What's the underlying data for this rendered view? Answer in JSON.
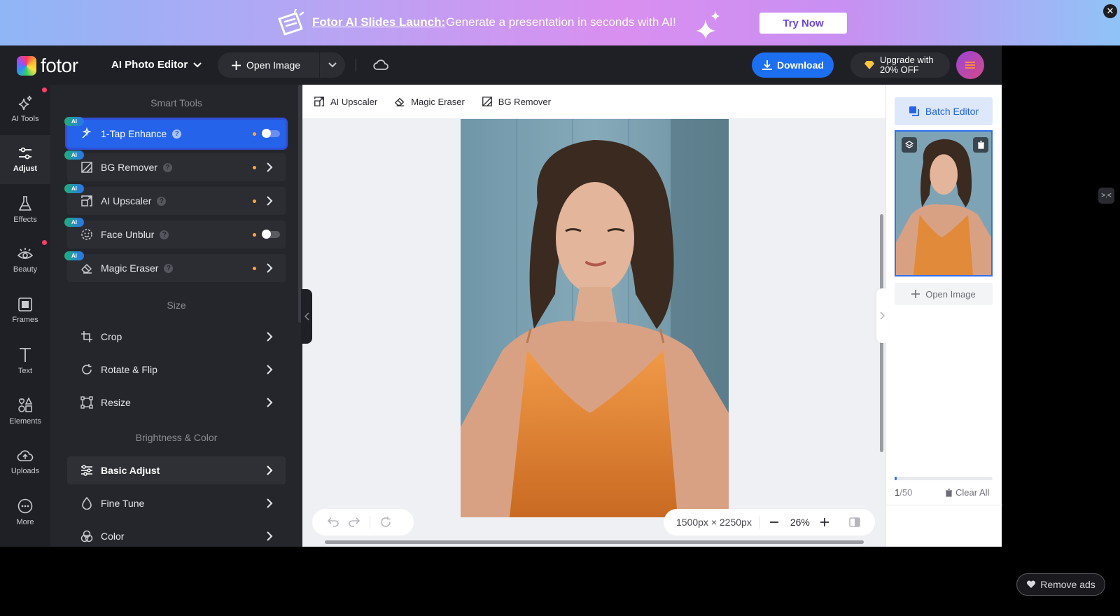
{
  "banner": {
    "title": "Fotor AI Slides Launch:",
    "text": "Generate a presentation in seconds with AI!",
    "cta": "Try Now",
    "close": "✕"
  },
  "topbar": {
    "logo": "fotor",
    "editor_mode": "AI Photo Editor",
    "open_image": "Open Image",
    "download": "Download",
    "upgrade_line1": "Upgrade with",
    "upgrade_line2": "20% OFF"
  },
  "rail": [
    {
      "label": "AI Tools"
    },
    {
      "label": "Adjust"
    },
    {
      "label": "Effects"
    },
    {
      "label": "Beauty"
    },
    {
      "label": "Frames"
    },
    {
      "label": "Text"
    },
    {
      "label": "Elements"
    },
    {
      "label": "Uploads"
    },
    {
      "label": "More"
    }
  ],
  "panel": {
    "smart_tools_title": "Smart Tools",
    "ai_badge": "AI",
    "smart_tools": [
      {
        "label": "1-Tap Enhance",
        "control": "toggle",
        "toggle_on": false
      },
      {
        "label": "BG Remover",
        "control": "arrow"
      },
      {
        "label": "AI Upscaler",
        "control": "arrow"
      },
      {
        "label": "Face Unblur",
        "control": "toggle",
        "toggle_on": false
      },
      {
        "label": "Magic Eraser",
        "control": "arrow"
      }
    ],
    "size_title": "Size",
    "size_tools": [
      {
        "label": "Crop"
      },
      {
        "label": "Rotate & Flip"
      },
      {
        "label": "Resize"
      }
    ],
    "brightness_title": "Brightness & Color",
    "brightness_tools": [
      {
        "label": "Basic Adjust"
      },
      {
        "label": "Fine Tune"
      },
      {
        "label": "Color"
      }
    ]
  },
  "workspace": {
    "toolbar": [
      {
        "label": "AI Upscaler"
      },
      {
        "label": "Magic Eraser"
      },
      {
        "label": "BG Remover"
      }
    ],
    "dimensions": "1500px × 2250px",
    "zoom": "26%"
  },
  "rightpanel": {
    "batch_editor": "Batch Editor",
    "open_image": "Open Image",
    "count_current": "1",
    "count_total": "/50",
    "clear_all": "Clear All",
    "progress_fraction": 0.02
  },
  "overlay": {
    "remove_ads": "Remove ads",
    "side_button": ">.<"
  },
  "colors": {
    "accent": "#2563eb",
    "download": "#1d6ff2",
    "ai_dot": "#ffa640",
    "notification": "#ff3d6a"
  }
}
